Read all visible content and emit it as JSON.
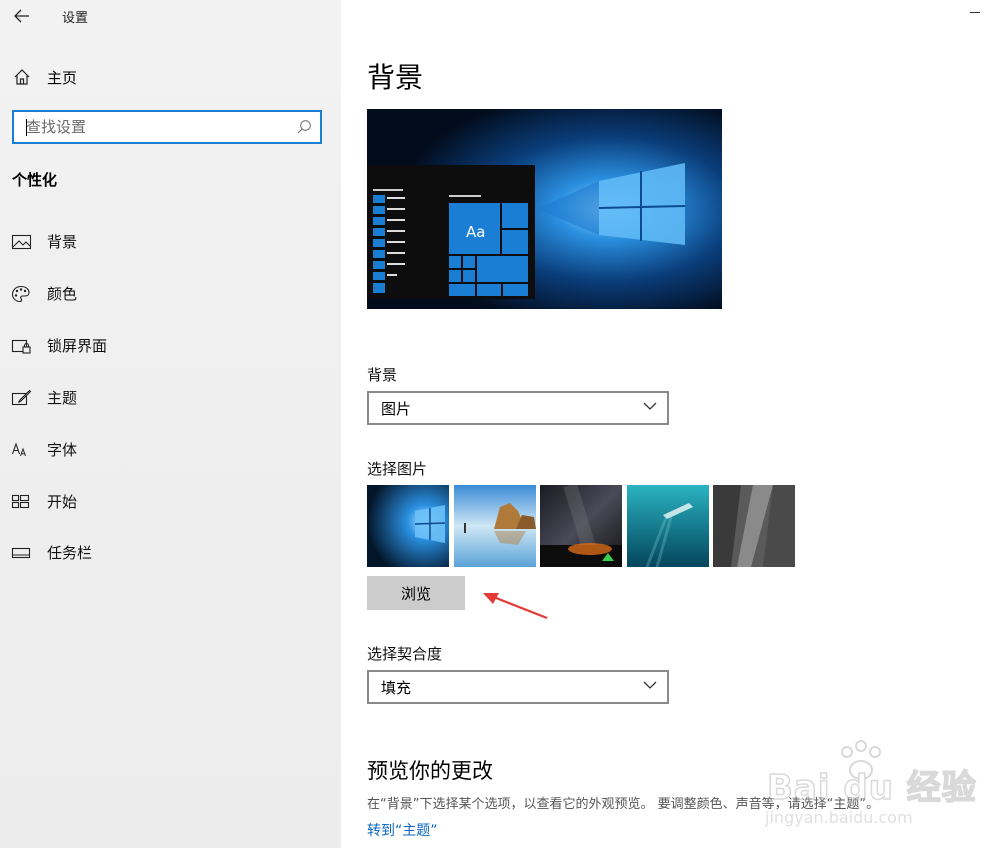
{
  "window": {
    "title": "设置"
  },
  "sidebar": {
    "home_label": "主页",
    "search_placeholder": "查找设置",
    "section_title": "个性化",
    "items": [
      {
        "label": "背景",
        "icon": "picture-icon"
      },
      {
        "label": "颜色",
        "icon": "palette-icon"
      },
      {
        "label": "锁屏界面",
        "icon": "lock-screen-icon"
      },
      {
        "label": "主题",
        "icon": "theme-brush-icon"
      },
      {
        "label": "字体",
        "icon": "font-icon"
      },
      {
        "label": "开始",
        "icon": "start-tiles-icon"
      },
      {
        "label": "任务栏",
        "icon": "taskbar-icon"
      }
    ]
  },
  "main": {
    "page_title": "背景",
    "preview_sample_text": "Aa",
    "background_label": "背景",
    "background_value": "图片",
    "choose_picture_label": "选择图片",
    "browse_label": "浏览",
    "fit_label": "选择契合度",
    "fit_value": "填充",
    "preview_changes_title": "预览你的更改",
    "preview_changes_desc": "在“背景”下选择某个选项，以查看它的外观预览。 要调整颜色、声音等，请选择“主题”。",
    "go_to_themes_link": "转到“主题”"
  },
  "watermark": {
    "brand": "Bai du 经验",
    "url": "jingyan.baidu.com"
  },
  "colors": {
    "accent": "#1a7fd4",
    "link": "#0a67c4",
    "sidebar_bg": "#f0f0f0",
    "annotation_arrow": "#e53935"
  }
}
